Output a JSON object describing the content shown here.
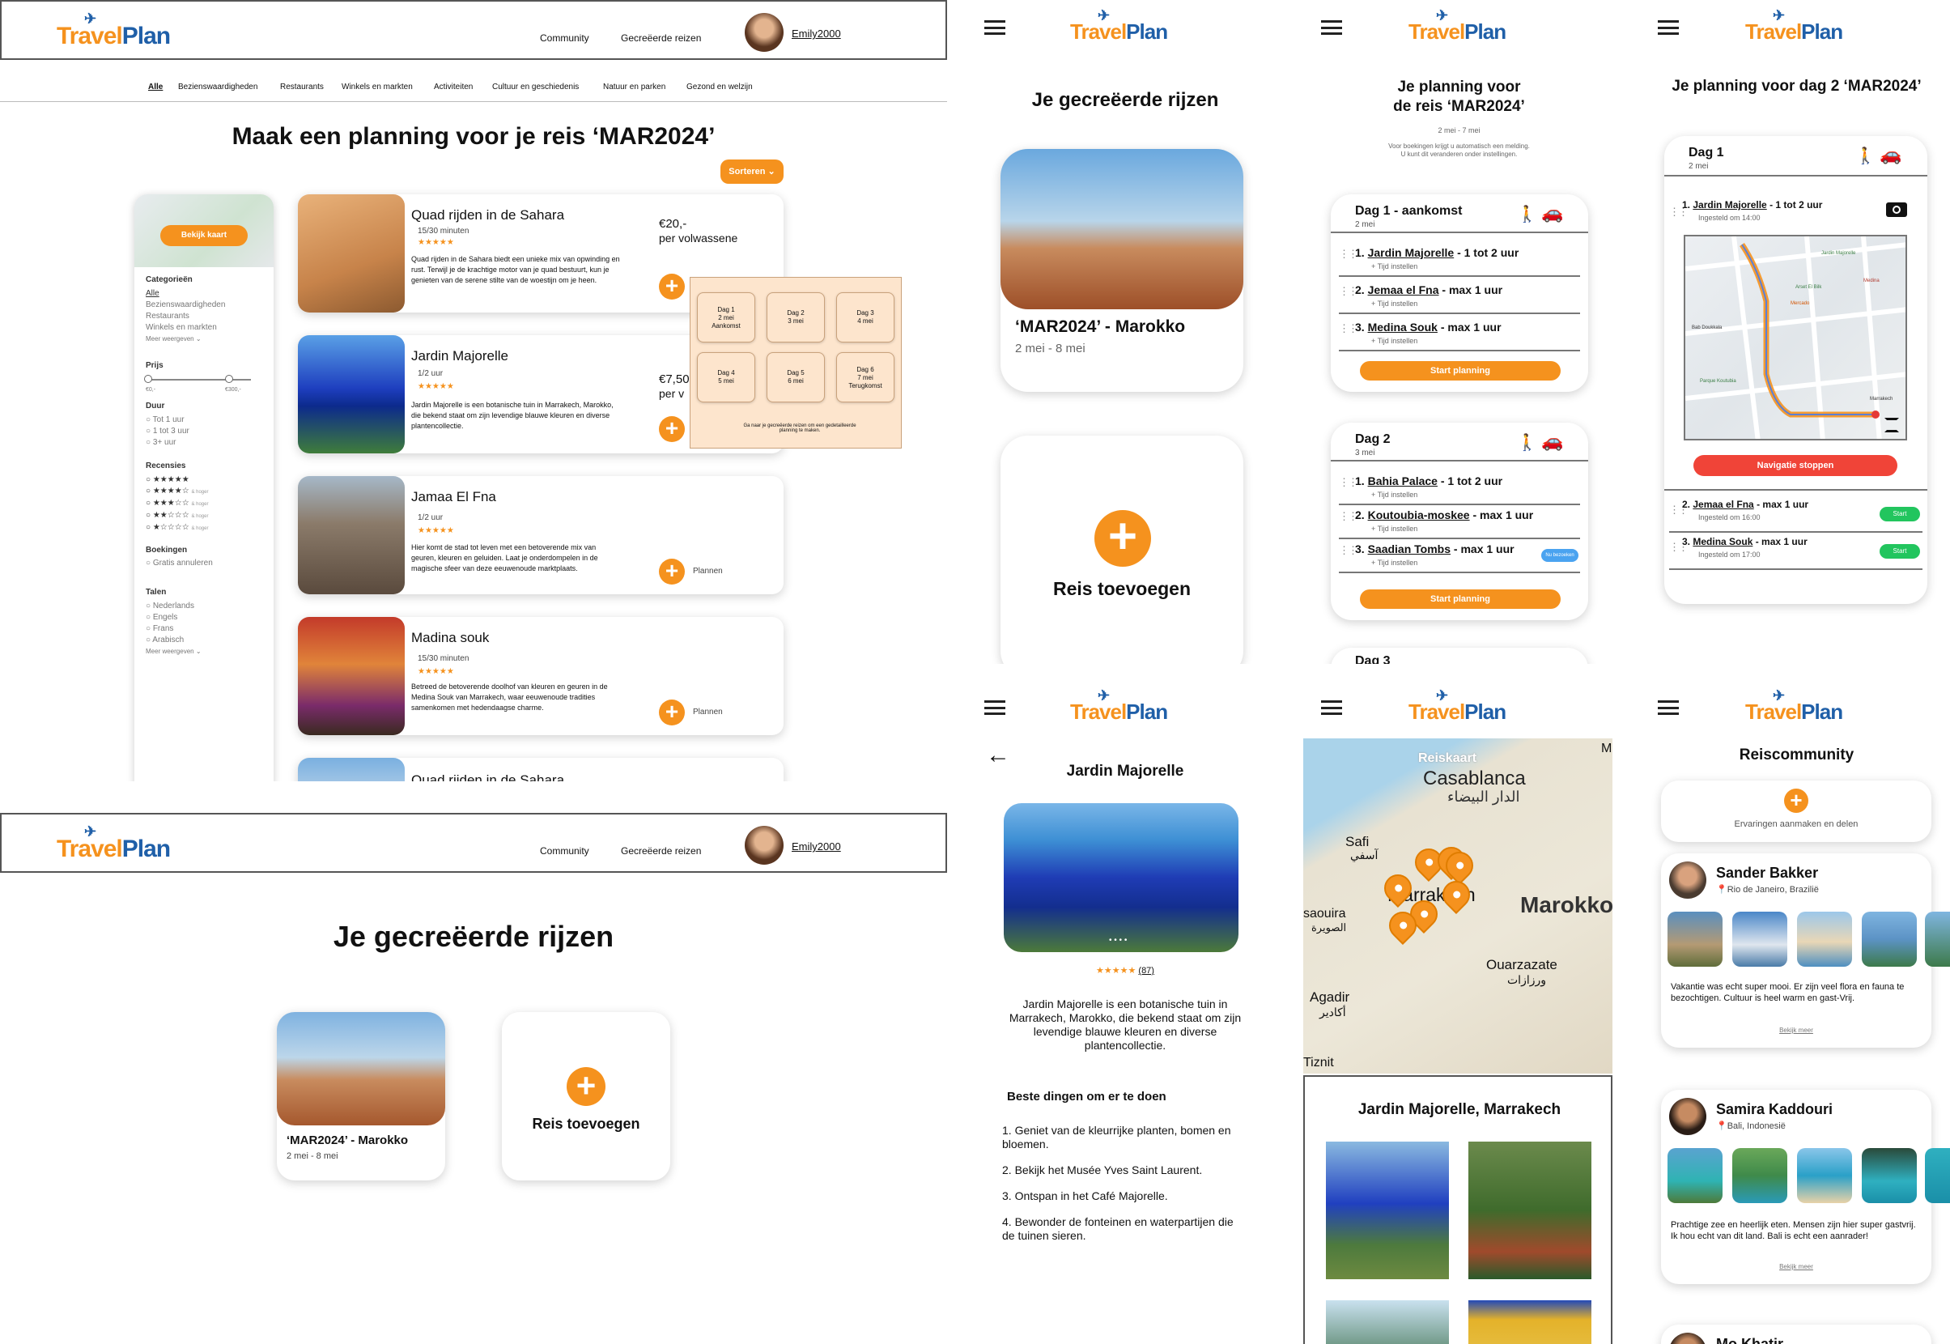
{
  "brand": {
    "logo_part1": "Travel",
    "logo_part2": "Plan"
  },
  "desktop_nav": {
    "community": "Community",
    "trips": "Gecreëerde reizen",
    "user": "Emily2000"
  },
  "filter_tabs": [
    "Alle",
    "Bezienswaardigheden",
    "Restaurants",
    "Winkels en markten",
    "Activiteiten",
    "Cultuur en geschiedenis",
    "Natuur en parken",
    "Gezond en welzijn"
  ],
  "planner": {
    "title": "Maak een planning voor je reis ‘MAR2024’",
    "sort_label": "Sorteren",
    "map_button": "Bekijk kaart",
    "sidebar": {
      "categories_h": "Categorieën",
      "categories": [
        "Alle",
        "Bezienswaardigheden",
        "Restaurants",
        "Winkels en markten"
      ],
      "more": "Meer weergeven",
      "price_h": "Prijs",
      "price_min": "€0,-",
      "price_max": "€300,-",
      "duration_h": "Duur",
      "durations": [
        "Tot 1 uur",
        "1 tot 3 uur",
        "3+ uur"
      ],
      "reviews_h": "Recensies",
      "reviews": [
        "★★★★★",
        "★★★★☆",
        "★★★☆☆",
        "★★☆☆☆",
        "★☆☆☆☆"
      ],
      "review_note": "& hoger",
      "bookings_h": "Boekingen",
      "bookings": "Gratis annuleren",
      "languages_h": "Talen",
      "languages": [
        "Nederlands",
        "Engels",
        "Frans",
        "Arabisch"
      ]
    },
    "activities": [
      {
        "name": "Quad rijden in de Sahara",
        "duration": "15/30 minuten",
        "stars": "★★★★★",
        "desc": "Quad rijden in de Sahara biedt een unieke mix van opwinding en rust. Terwijl je de krachtige motor van je quad bestuurt, kun je genieten van de serene stilte van de woestijn om je heen.",
        "price": "€20,-",
        "price_note": "per volwassene",
        "action": ""
      },
      {
        "name": "Jardin Majorelle",
        "duration": "1/2 uur",
        "stars": "★★★★★",
        "desc": "Jardin Majorelle is een botanische tuin in Marrakech, Marokko, die bekend staat om zijn levendige blauwe kleuren en diverse plantencollectie.",
        "price": "€7,50",
        "price_note": "per v",
        "action": ""
      },
      {
        "name": "Jamaa El Fna",
        "duration": "1/2 uur",
        "stars": "★★★★★",
        "desc": "Hier komt de stad tot leven met een betoverende mix van geuren, kleuren en geluiden. Laat je onderdompelen in de magische sfeer van deze eeuwenoude marktplaats.",
        "price": "",
        "price_note": "",
        "action": "Plannen"
      },
      {
        "name": "Madina souk",
        "duration": "15/30 minuten",
        "stars": "★★★★★",
        "desc": "Betreed de betoverende doolhof van kleuren en geuren in de Medina Souk van Marrakech, waar eeuwenoude tradities samenkomen met hedendaagse charme.",
        "price": "",
        "price_note": "",
        "action": "Plannen"
      }
    ],
    "cut_off_card": "Quad rijden in de Sahara",
    "day_popup": {
      "days": [
        [
          "Dag 1",
          "2 mei",
          "Aankomst"
        ],
        [
          "Dag 2",
          "3 mei",
          ""
        ],
        [
          "Dag 3",
          "4 mei",
          ""
        ],
        [
          "Dag 4",
          "5 mei",
          ""
        ],
        [
          "Dag 5",
          "6 mei",
          ""
        ],
        [
          "Dag 6",
          "7 mei",
          "Terugkomst"
        ]
      ],
      "note": "Ga naar je gecreëerde reizen om een gedetailleerde planning te maken."
    }
  },
  "trips_desktop": {
    "title": "Je gecreëerde rijzen",
    "trip_name": "‘MAR2024’ - Marokko",
    "trip_dates": "2 mei - 8 mei",
    "add_label": "Reis toevoegen"
  },
  "mobile_trips": {
    "title": "Je gecreëerde rijzen",
    "trip_name": "‘MAR2024’ - Marokko",
    "trip_dates": "2 mei - 8 mei",
    "add_label": "Reis toevoegen"
  },
  "mobile_planning": {
    "title1": "Je planning voor",
    "title2": "de reis ‘MAR2024’",
    "dates": "2 mei - 7 mei",
    "note1": "Voor boekingen krijgt u automatisch een melding.",
    "note2": "U kunt dit veranderen onder instellingen.",
    "time_label": "Tijd instellen",
    "start_label": "Start planning",
    "badge": "Nu bezoeken",
    "day1": {
      "title": "Dag 1 - aankomst",
      "date": "2 mei",
      "items": [
        [
          "1.",
          "Jardin Majorelle",
          "- 1 tot 2 uur"
        ],
        [
          "2.",
          "Jemaa el Fna",
          "- max 1 uur"
        ],
        [
          "3.",
          "Medina Souk",
          "- max 1 uur"
        ]
      ]
    },
    "day2": {
      "title": "Dag 2",
      "date": "3 mei",
      "items": [
        [
          "1.",
          "Bahia Palace",
          "- 1 tot 2 uur"
        ],
        [
          "2.",
          "Koutoubia-moskee",
          "- max 1 uur"
        ],
        [
          "3.",
          "Saadian Tombs",
          "- max 1 uur"
        ]
      ]
    },
    "day3": "Dag 3"
  },
  "mobile_day": {
    "title": "Je planning voor dag 2 ‘MAR2024’",
    "day": "Dag 1",
    "date": "2 mei",
    "item1": [
      "1.",
      "Jardin Majorelle",
      "- 1 tot 2 uur"
    ],
    "item1_time": "Ingesteld om 14:00",
    "stop_label": "Navigatie stoppen",
    "item2": [
      "2.",
      "Jemaa el Fna",
      "- max 1 uur"
    ],
    "item2_time": "Ingesteld om 16:00",
    "item3": [
      "3.",
      "Medina Souk",
      "- max 1 uur"
    ],
    "item3_time": "Ingesteld om 17:00",
    "start": "Start",
    "map_labels": [
      "Jardin Majorelle",
      "Marrakech",
      "Arset El Bilk",
      "Mercado",
      "Parque Koutubia",
      "Medina",
      "Bab Doukkala"
    ]
  },
  "mobile_detail": {
    "title": "Jardin Majorelle",
    "stars": "★★★★★",
    "reviews": "(87)",
    "desc": "Jardin Majorelle is een botanische tuin in Marrakech, Marokko, die bekend staat om zijn levendige blauwe kleuren en diverse plantencollectie.",
    "todo_h": "Beste dingen om er te doen",
    "todo": [
      "1. Geniet van de kleurrijke planten, bomen en bloemen.",
      "2. Bekijk het Musée Yves Saint Laurent.",
      "3. Ontspan in het Café Majorelle.",
      "4. Bewonder de fonteinen en waterpartijen die de tuinen sieren."
    ]
  },
  "mobile_map": {
    "map_title": "Reiskaart",
    "cities": [
      "Casablanca",
      "الدار البيضاء",
      "Safi",
      "آسفي",
      "Marrakech",
      "Marokko",
      "saouira",
      "الصويرة",
      "Agadir",
      "أكادير",
      "Ouarzazate",
      "ورزازات",
      "Tiznit",
      "M"
    ],
    "panel_title": "Jardin Majorelle, Marrakech"
  },
  "mobile_community": {
    "title": "Reiscommunity",
    "create_label": "Ervaringen aanmaken en delen",
    "more": "Bekijk meer",
    "posts": [
      {
        "name": "Sander Bakker",
        "location": "Rio de Janeiro, Brazilië",
        "text": "Vakantie was echt super mooi. Er zijn veel flora en fauna te bezochtigen. Cultuur is heel warm en gast-Vrij."
      },
      {
        "name": "Samira Kaddouri",
        "location": "Bali, Indonesië",
        "text": "Prachtige zee en heerlijk eten. Mensen zijn hier super gastvrij. Ik hou echt van dit land. Bali is echt een aanrader!"
      },
      {
        "name": "Mo Khatir",
        "location": "",
        "text": ""
      }
    ]
  },
  "colors": {
    "accent": "#f5921e",
    "brand_blue": "#1f5fa8",
    "stop_red": "#f04438",
    "start_green": "#22c55e"
  }
}
